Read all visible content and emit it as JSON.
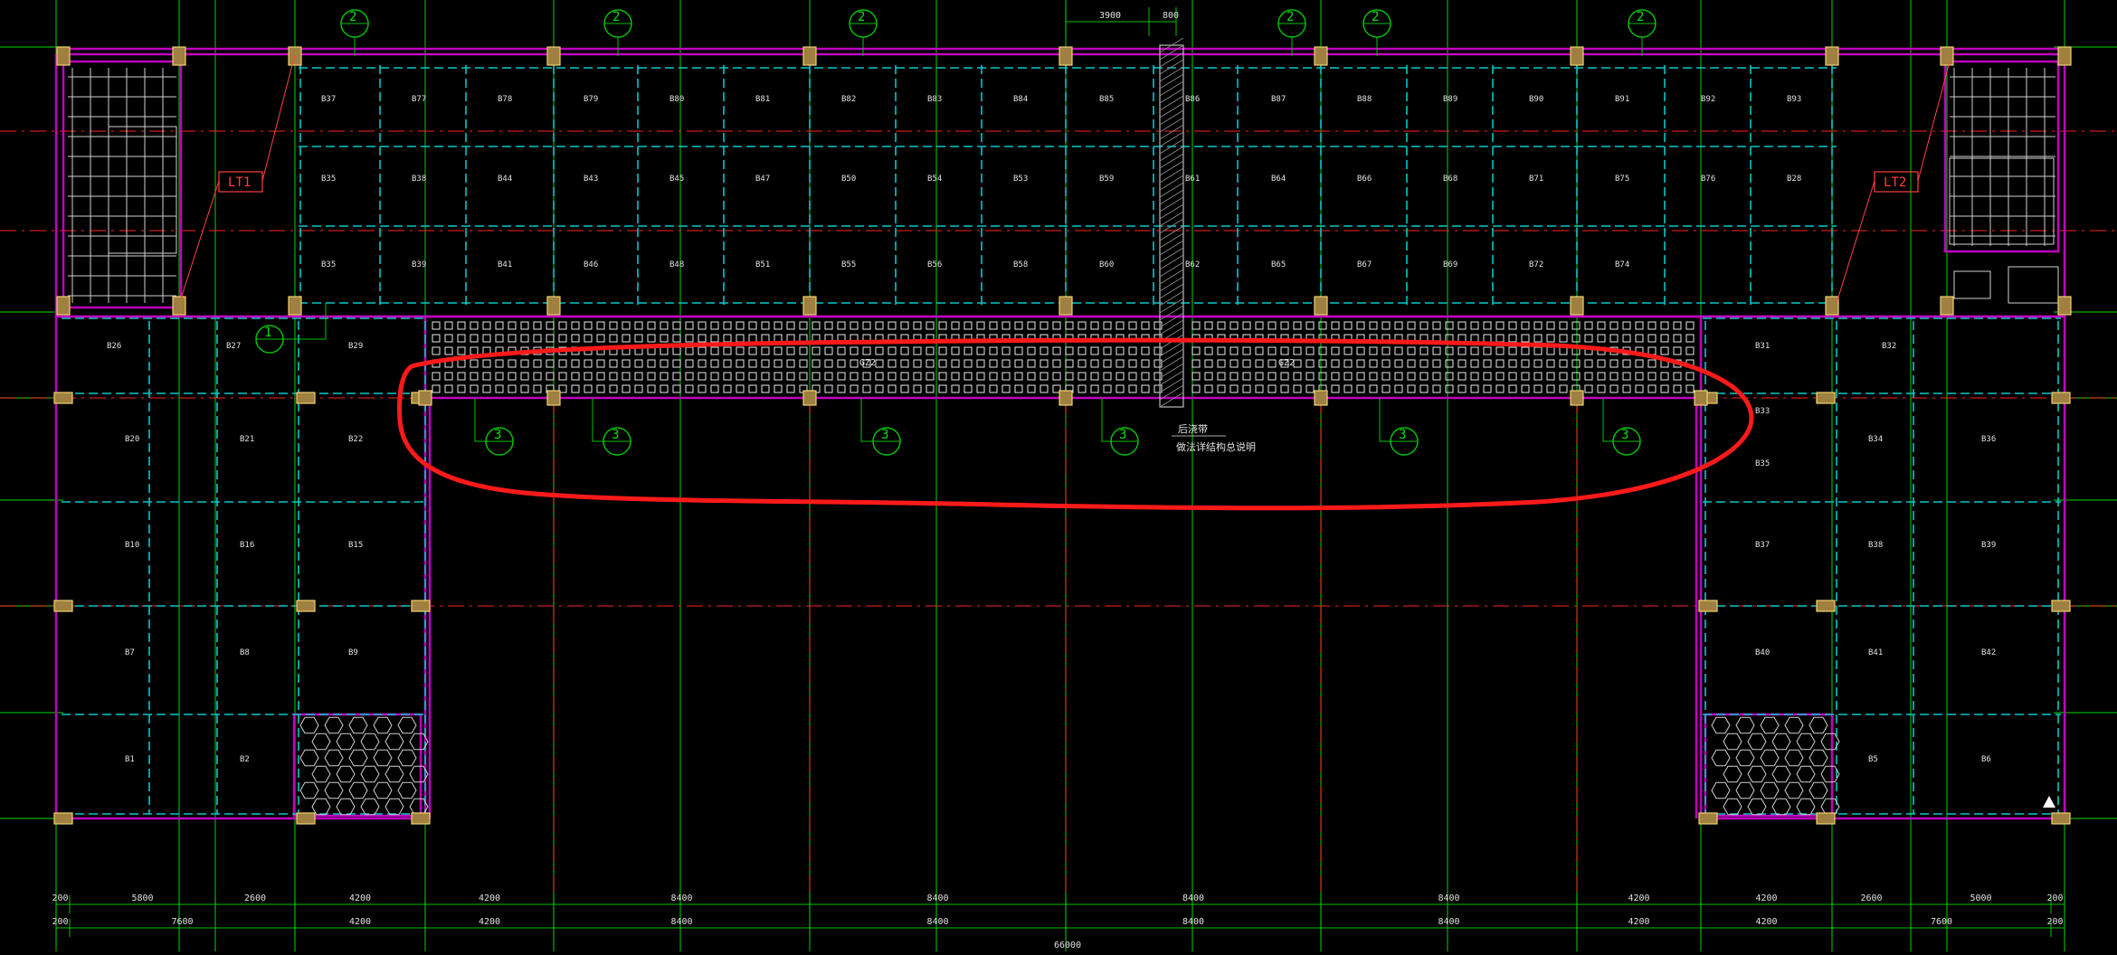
{
  "drawing": {
    "background": "#000000",
    "colors": {
      "grid": "#00c000",
      "axis": "#ff2020",
      "wall": "#c000c0",
      "beam": "#00c8c8",
      "column": "#e0c060",
      "text": "#e0e0e0",
      "highlight": "#ff1a1a",
      "dim_text": "#e0e0e0"
    },
    "top_markers": [
      {
        "label": "2"
      },
      {
        "label": "2"
      },
      {
        "label": "2"
      },
      {
        "label": "2"
      },
      {
        "label": "2"
      },
      {
        "label": "2"
      }
    ],
    "top_dimensions": [
      "3900",
      "800"
    ],
    "section_marker_1": "1",
    "section_markers_3": [
      "3",
      "3",
      "3",
      "3",
      "3",
      "3"
    ],
    "stair_labels": [
      "LT1",
      "LT2"
    ],
    "beam_labels": [
      "GZ2",
      "GZ2"
    ],
    "note_lines": [
      "后浇带",
      "做法详结构总说明"
    ],
    "room_codes_top": [
      "B37",
      "B77",
      "B78",
      "B79",
      "B80",
      "B81",
      "B82",
      "B83",
      "B84",
      "B85",
      "B86",
      "B87",
      "B88",
      "B89",
      "B90",
      "B91",
      "B92",
      "B93",
      "B35",
      "B38",
      "B44",
      "B43",
      "B45",
      "B47",
      "B50",
      "B54",
      "B53",
      "B59",
      "B61",
      "B64",
      "B66",
      "B68",
      "B71",
      "B75",
      "B76",
      "B28",
      "B35",
      "B39",
      "B41",
      "B46",
      "B48",
      "B51",
      "B55",
      "B56",
      "B58",
      "B60",
      "B62",
      "B65",
      "B67",
      "B69",
      "B72",
      "B74"
    ],
    "room_codes_mid": [
      "B26",
      "B27",
      "B29",
      "B31",
      "B32"
    ],
    "room_codes_left": [
      "B20",
      "B21",
      "B22",
      "B10",
      "B16",
      "B15",
      "B7",
      "B8",
      "B9",
      "B1",
      "B2"
    ],
    "room_codes_right": [
      "B33",
      "B34",
      "B36",
      "B35",
      "B37",
      "B38",
      "B39",
      "B40",
      "B41",
      "B42",
      "B5",
      "B6"
    ],
    "bottom_dims_row1": [
      "200",
      "5800",
      "2600",
      "4200",
      "4200",
      "8400",
      "8400",
      "8400",
      "8400",
      "4200",
      "4200",
      "2600",
      "5000",
      "200"
    ],
    "bottom_dims_row2": [
      "200",
      "7600",
      "4200",
      "4200",
      "8400",
      "8400",
      "8400",
      "8400",
      "4200",
      "4200",
      "7600",
      "200"
    ],
    "bottom_total": "66000"
  }
}
